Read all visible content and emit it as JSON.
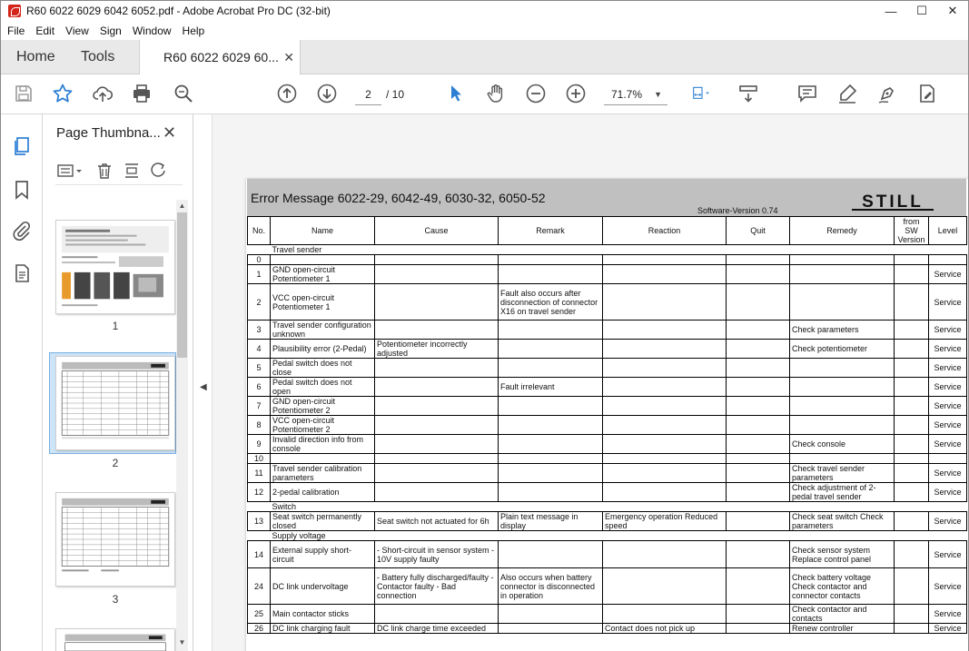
{
  "window": {
    "title": "R60 6022 6029 6042 6052.pdf - Adobe Acrobat Pro DC (32-bit)"
  },
  "menu": [
    "File",
    "Edit",
    "View",
    "Sign",
    "Window",
    "Help"
  ],
  "tabs": {
    "home": "Home",
    "tools": "Tools",
    "document": "R60 6022 6029 60..."
  },
  "toolbar": {
    "page_current": "2",
    "page_total": "/ 10",
    "zoom": "71.7%"
  },
  "panel": {
    "title": "Page Thumbna...",
    "thumbnails": [
      "1",
      "2",
      "3"
    ]
  },
  "doc": {
    "title": "Error Message 6022-29, 6042-49, 6030-32, 6050-52",
    "software_version": "Software-Version 0.74",
    "logo": "STILL",
    "headers": [
      "No.",
      "Name",
      "Cause",
      "Remark",
      "Reaction",
      "Quit",
      "Remedy",
      "from SW Version",
      "Level"
    ],
    "rows": [
      {
        "section": "Travel sender"
      },
      {
        "no": "0",
        "name": "",
        "cause": "",
        "remark": "",
        "reaction": "",
        "remedy": "",
        "level": ""
      },
      {
        "no": "1",
        "name": "GND open-circuit Potentiometer 1",
        "cause": "",
        "remark": "",
        "reaction": "",
        "remedy": "",
        "level": "Service"
      },
      {
        "no": "2",
        "name": "VCC open-circuit Potentiometer 1",
        "cause": "",
        "remark": "Fault also occurs after disconnection of connector X16 on travel sender",
        "reaction": "",
        "remedy": "",
        "level": "Service"
      },
      {
        "no": "3",
        "name": "Travel sender configuration unknown",
        "cause": "",
        "remark": "",
        "reaction": "",
        "remedy": "Check parameters",
        "level": "Service"
      },
      {
        "no": "4",
        "name": "Plausibility error (2-Pedal)",
        "cause": "Potentiometer incorrectly adjusted",
        "remark": "",
        "reaction": "",
        "remedy": "Check potentiometer",
        "level": "Service"
      },
      {
        "no": "5",
        "name": "Pedal switch does not close",
        "cause": "",
        "remark": "",
        "reaction": "",
        "remedy": "",
        "level": "Service"
      },
      {
        "no": "6",
        "name": "Pedal switch does not open",
        "cause": "",
        "remark": "Fault irrelevant",
        "reaction": "",
        "remedy": "",
        "level": "Service"
      },
      {
        "no": "7",
        "name": "GND open-circuit Potentiometer 2",
        "cause": "",
        "remark": "",
        "reaction": "",
        "remedy": "",
        "level": "Service"
      },
      {
        "no": "8",
        "name": "VCC open-circuit Potentiometer 2",
        "cause": "",
        "remark": "",
        "reaction": "",
        "remedy": "",
        "level": "Service"
      },
      {
        "no": "9",
        "name": "Invalid direction info from console",
        "cause": "",
        "remark": "",
        "reaction": "",
        "remedy": "Check console",
        "level": "Service"
      },
      {
        "no": "10",
        "name": "",
        "cause": "",
        "remark": "",
        "reaction": "",
        "remedy": "",
        "level": ""
      },
      {
        "no": "11",
        "name": "Travel sender calibration parameters",
        "cause": "",
        "remark": "",
        "reaction": "",
        "remedy": "Check travel sender parameters",
        "level": "Service"
      },
      {
        "no": "12",
        "name": "2-pedal calibration",
        "cause": "",
        "remark": "",
        "reaction": "",
        "remedy": "Check adjustment of 2-pedal travel sender",
        "level": "Service"
      },
      {
        "section": "Switch"
      },
      {
        "no": "13",
        "name": "Seat switch permanently closed",
        "cause": "Seat switch not actuated for 6h",
        "remark": "Plain text message in display",
        "reaction": "Emergency operation Reduced speed",
        "remedy": "Check seat switch Check parameters",
        "level": "Service"
      },
      {
        "section": "Supply voltage"
      },
      {
        "no": "14",
        "name": "External supply short-circuit",
        "cause": "- Short-circuit in sensor system - 10V supply faulty",
        "remark": "",
        "reaction": "",
        "remedy": "Check sensor system Replace control panel",
        "level": "Service"
      },
      {
        "no": "24",
        "name": "DC link undervoltage",
        "cause": "- Battery fully discharged/faulty - Contactor faulty - Bad connection",
        "remark": "Also occurs when battery connector is disconnected in operation",
        "reaction": "",
        "remedy": "Check battery voltage Check contactor and connector contacts",
        "level": "Service"
      },
      {
        "no": "25",
        "name": "Main contactor sticks",
        "cause": "",
        "remark": "",
        "reaction": "",
        "remedy": "Check contactor and contacts",
        "level": "Service"
      },
      {
        "no": "26",
        "name": "DC link charging fault",
        "cause": "DC link charge time exceeded",
        "remark": "",
        "reaction": "Contact does not pick up",
        "remedy": "Renew controller",
        "level": "Service"
      }
    ]
  },
  "colors": {
    "accent": "#2d7fd3",
    "tab_bg": "#e9e9e9",
    "banner": "#c0c0c0"
  }
}
